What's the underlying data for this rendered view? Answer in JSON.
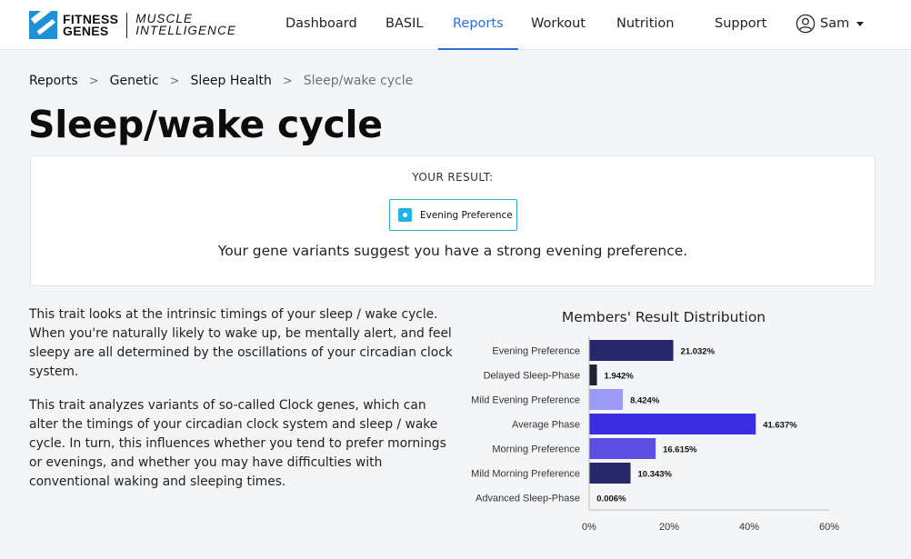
{
  "brand": {
    "fitness_genes": [
      "FITNESS",
      "GENES"
    ],
    "muscle_intelligence": [
      "MUSCLE",
      "INTELLIGENCE"
    ]
  },
  "nav": {
    "items": [
      {
        "label": "Dashboard",
        "active": false
      },
      {
        "label": "BASIL",
        "active": false
      },
      {
        "label": "Reports",
        "active": true
      },
      {
        "label": "Workout",
        "active": false
      },
      {
        "label": "Nutrition",
        "active": false
      },
      {
        "label": "Support",
        "active": false
      }
    ],
    "user": {
      "name": "Sam",
      "icon": "user-circle-icon"
    }
  },
  "breadcrumb": [
    "Reports",
    "Genetic",
    "Sleep Health",
    "Sleep/wake cycle"
  ],
  "page_title": "Sleep/wake cycle",
  "result": {
    "label": "YOUR RESULT:",
    "value": "Evening Preference",
    "description": "Your gene variants suggest you have a strong evening preference."
  },
  "description": [
    "This trait looks at the intrinsic timings of your sleep / wake cycle. When you're naturally likely to wake up, be mentally alert, and feel sleepy are all determined by the oscillations of your circadian clock system.",
    "This trait analyzes variants of so-called Clock genes, which can alter the timings of your circadian clock system and sleep / wake cycle. In turn, this influences whether you tend to prefer mornings or evenings, and whether you may have difficulties with conventional waking and sleeping times."
  ],
  "chart_data": {
    "type": "bar",
    "orientation": "horizontal",
    "title": "Members' Result Distribution",
    "categories": [
      "Evening Preference",
      "Delayed Sleep-Phase",
      "Mild Evening Preference",
      "Average Phase",
      "Morning Preference",
      "Mild Morning Preference",
      "Advanced Sleep-Phase"
    ],
    "values": [
      21.032,
      1.942,
      8.424,
      41.637,
      16.615,
      10.343,
      0.006
    ],
    "labels": [
      "21.032%",
      "1.942%",
      "8.424%",
      "41.637%",
      "16.615%",
      "10.343%",
      "0.006%"
    ],
    "colors": [
      "#27286a",
      "#232330",
      "#9b9bf5",
      "#3a2ee0",
      "#5a4fe0",
      "#27286a",
      "#27286a"
    ],
    "xlim": [
      0,
      60
    ],
    "xticks": [
      "0%",
      "20%",
      "40%",
      "60%"
    ],
    "grid": false
  }
}
